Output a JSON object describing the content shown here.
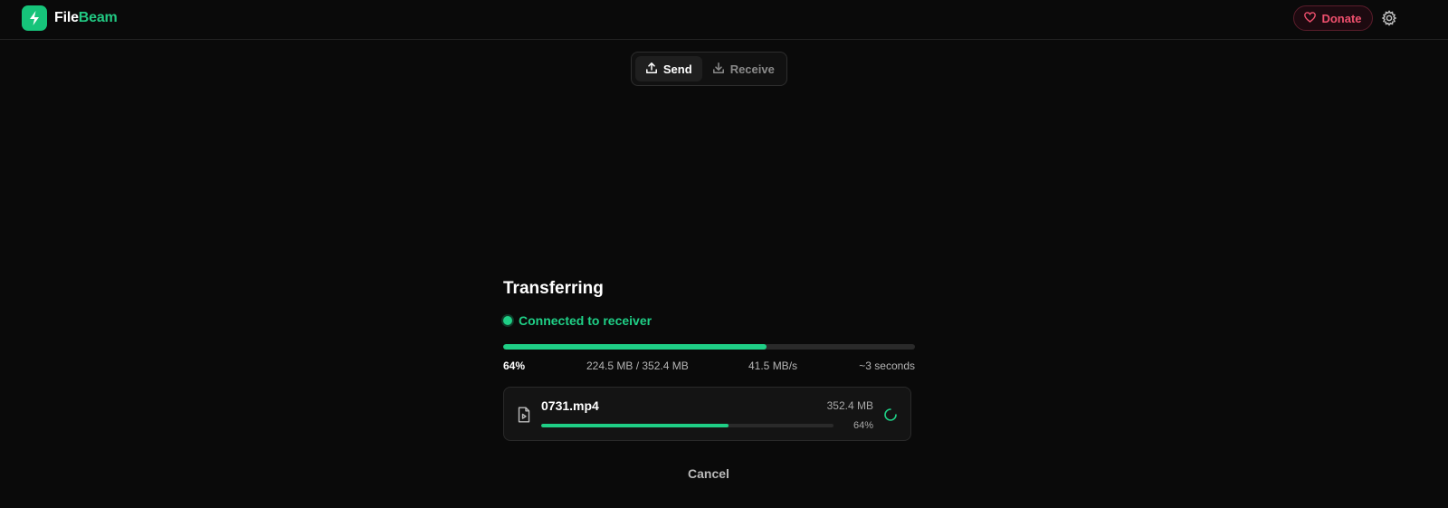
{
  "header": {
    "brand_part1": "File",
    "brand_part2": "Beam",
    "logo_icon": "lightning-bolt-icon",
    "donate_label": "Donate",
    "donate_icon": "heart-icon",
    "settings_icon": "gear-icon"
  },
  "mode_toggle": {
    "send_label": "Send",
    "receive_label": "Receive",
    "selected": "Send"
  },
  "transfer": {
    "title": "Transferring",
    "status": "Connected to receiver",
    "progress_fraction": 0.64,
    "progress_label": "64%",
    "size_label": "224.5 MB / 352.4 MB",
    "speed_label": "41.5 MB/s",
    "eta_label": "~3 seconds"
  },
  "files": [
    {
      "name": "0731.mp4",
      "size": "352.4 MB",
      "progress_label": "64%",
      "progress_fraction": 0.64,
      "icon": "video-file-icon",
      "state_icon": "loading-spinner-icon"
    }
  ],
  "cancel_label": "Cancel",
  "colors": {
    "accent": "#1fcf86",
    "background": "#0a0a0a",
    "donate": "#f0506e"
  }
}
